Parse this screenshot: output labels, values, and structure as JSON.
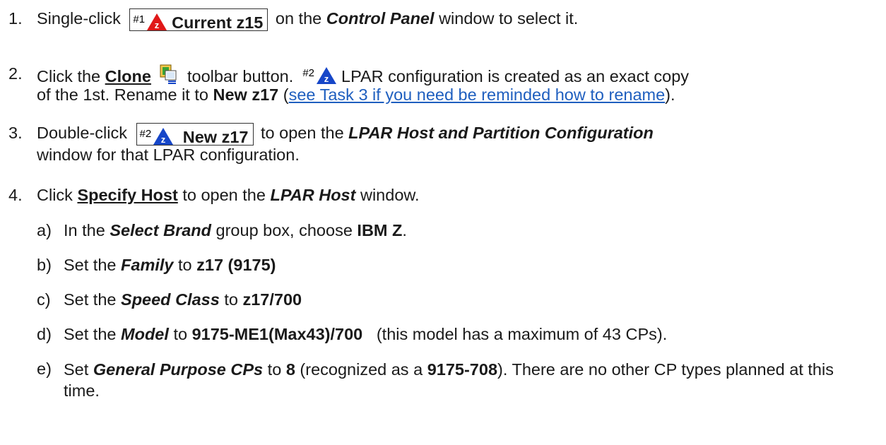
{
  "steps": {
    "s1": {
      "num": "1.",
      "pre": "Single-click",
      "box_tag": "#1",
      "box_label": "Current z15",
      "mid": "on the",
      "window": "Control Panel",
      "post": "window to select it."
    },
    "s2": {
      "num": "2.",
      "pre": "Click the",
      "button": "Clone",
      "mid": "toolbar button.",
      "tag": "#2",
      "line1_post": "LPAR configuration is created as an exact copy",
      "line2_pre": "of the 1st.  Rename it to",
      "name": "New z17",
      "paren_open": "(",
      "link": "see Task 3 if you need be reminded how to rename",
      "paren_close": ")."
    },
    "s3": {
      "num": "3.",
      "pre": "Double-click",
      "box_tag": "#2",
      "box_label": "New z17",
      "mid": "to open the",
      "window": "LPAR Host and Partition Configuration",
      "line2": "window for that LPAR configuration."
    },
    "s4": {
      "num": "4.",
      "pre": "Click",
      "button": "Specify Host",
      "mid": "to open the",
      "window": "LPAR Host",
      "post": "window.",
      "subs": {
        "a": {
          "letter": "a)",
          "pre": "In the",
          "field": "Select Brand",
          "mid": "group box, choose",
          "value": "IBM Z",
          "post": "."
        },
        "b": {
          "letter": "b)",
          "pre": "Set the",
          "field": "Family",
          "mid": "to",
          "value": "z17 (9175)"
        },
        "c": {
          "letter": "c)",
          "pre": "Set the",
          "field": "Speed Class",
          "mid": "to",
          "value": "z17/700"
        },
        "d": {
          "letter": "d)",
          "pre": "Set the",
          "field": "Model",
          "mid": "to",
          "value": "9175-ME1(Max43)/700",
          "post": "  (this model has a maximum of 43 CPs)."
        },
        "e": {
          "letter": "e)",
          "pre": "Set",
          "field": "General Purpose CPs",
          "mid": "to",
          "value": "8",
          "post1": "(recognized as a",
          "model": "9175-708",
          "post2": ").  There are no other CP types planned at this time."
        }
      }
    }
  },
  "icons": {
    "lpar1": "red-lpar-z-icon",
    "lpar2": "blue-lpar-z-icon",
    "clone": "clone-icon",
    "red": "#e01818",
    "blue": "#1646c8"
  }
}
